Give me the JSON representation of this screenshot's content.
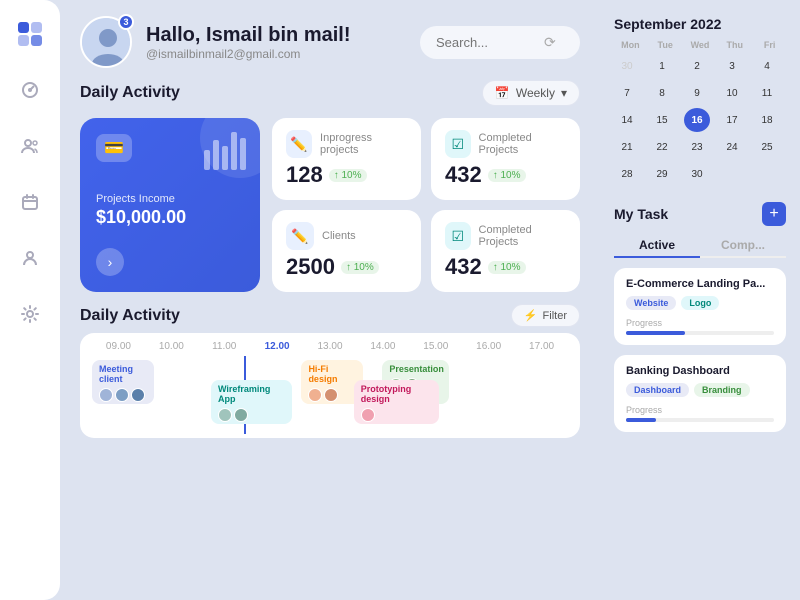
{
  "sidebar": {
    "logo_icon": "grid-icon",
    "items": [
      {
        "id": "dashboard",
        "icon": "pie-icon",
        "active": false
      },
      {
        "id": "people",
        "icon": "people-icon",
        "active": false
      },
      {
        "id": "calendar",
        "icon": "calendar-icon",
        "active": false
      },
      {
        "id": "team",
        "icon": "team-icon",
        "active": false
      },
      {
        "id": "settings",
        "icon": "settings-icon",
        "active": false
      }
    ]
  },
  "header": {
    "greeting": "Hallo, Ismail bin mail!",
    "email": "@ismailbinmail2@gmail.com",
    "badge": "3",
    "search_placeholder": "Search..."
  },
  "daily_activity": {
    "title": "Daily Activity",
    "period_label": "Weekly",
    "income_card": {
      "label": "Projects Income",
      "amount": "$10,000.00",
      "icon": "💳",
      "bars": [
        30,
        50,
        40,
        70,
        60
      ]
    },
    "stats": [
      {
        "id": "inprogress",
        "label": "Inprogress projects",
        "value": "128",
        "trend": "↑ 10%",
        "icon": "✏️",
        "icon_class": "blue"
      },
      {
        "id": "completed1",
        "label": "Completed Projects",
        "value": "432",
        "trend": "↑ 10%",
        "icon": "✅",
        "icon_class": "teal"
      },
      {
        "id": "clients",
        "label": "Clients",
        "value": "2500",
        "trend": "↑ 10%",
        "icon": "✏️",
        "icon_class": "blue"
      },
      {
        "id": "completed2",
        "label": "Completed Projects",
        "value": "432",
        "trend": "↑ 10%",
        "icon": "✅",
        "icon_class": "teal"
      }
    ]
  },
  "timeline": {
    "title": "Daily Activity",
    "filter_label": "Filter",
    "hours": [
      "09.00",
      "10.00",
      "11.00",
      "12.00",
      "13.00",
      "14.00",
      "15.00",
      "16.00",
      "17.00"
    ],
    "active_hour": "12.00",
    "events": [
      {
        "id": "meeting",
        "label": "Meeting client",
        "class": "meeting",
        "avatars": 3
      },
      {
        "id": "wireframe",
        "label": "Wireframing App",
        "class": "wireframe",
        "avatars": 2
      },
      {
        "id": "hifi",
        "label": "Hi-Fi design",
        "class": "hifi",
        "avatars": 2
      },
      {
        "id": "presentation",
        "label": "Presentation",
        "class": "presentation",
        "avatars": 2
      },
      {
        "id": "prototyping",
        "label": "Prototyping design",
        "class": "prototyping",
        "avatars": 1
      }
    ]
  },
  "calendar": {
    "title": "September 2022",
    "day_labels": [
      "Mon",
      "Tue",
      "Wed",
      "Thu",
      "Fri"
    ],
    "weeks": [
      [
        "30",
        "1",
        "2",
        "3",
        "4"
      ],
      [
        "7",
        "8",
        "9",
        "10",
        "11"
      ],
      [
        "14",
        "15",
        "16",
        "17",
        "18"
      ],
      [
        "21",
        "22",
        "23",
        "24",
        "25"
      ],
      [
        "28",
        "29",
        "30",
        "",
        ""
      ]
    ],
    "today": "16",
    "dimmed": [
      "30"
    ]
  },
  "my_task": {
    "title": "My Task",
    "add_label": "+",
    "tabs": [
      {
        "id": "active",
        "label": "Active",
        "active": true
      },
      {
        "id": "completed",
        "label": "Comp...",
        "active": false
      }
    ],
    "tasks": [
      {
        "id": "ecommerce",
        "title": "E-Commerce Landing Pa...",
        "tags": [
          {
            "label": "Website",
            "class": "website"
          },
          {
            "label": "Logo",
            "class": "logo"
          }
        ],
        "progress_label": "Progress",
        "progress": 40
      },
      {
        "id": "banking",
        "title": "Banking Dashboard",
        "tags": [
          {
            "label": "Dashboard",
            "class": "dashboard"
          },
          {
            "label": "Branding",
            "class": "branding"
          }
        ],
        "progress_label": "Progress",
        "progress": 20
      }
    ]
  }
}
